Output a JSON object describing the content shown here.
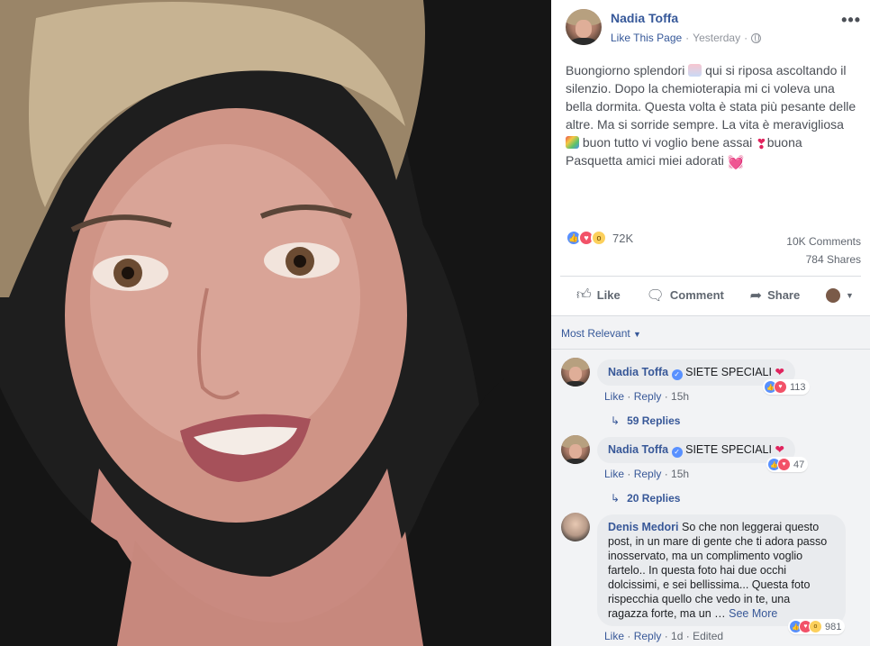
{
  "post": {
    "author": "Nadia Toffa",
    "like_page": "Like This Page",
    "separator": "·",
    "time": "Yesterday",
    "text_lines": [
      "Buongiorno splendori",
      "qui si riposa ascoltando il",
      "silenzio. Dopo la chemioterapia mi ci voleva una",
      "bella dormita. Questa volta è stata più pesante delle",
      "altre. Ma si sorride sempre. La vita è meravigliosa",
      "buon tutto vi voglio bene assai",
      "buona",
      "Pasquetta amici miei adorati"
    ],
    "reaction_count": "72K",
    "comments_count": "10K Comments",
    "shares_count": "784 Shares",
    "actions": {
      "like": "Like",
      "comment": "Comment",
      "share": "Share"
    }
  },
  "comments_section": {
    "sort_label": "Most Relevant",
    "comments": [
      {
        "author": "Nadia Toffa",
        "text": "SIETE SPECIALI",
        "like": "Like",
        "reply": "Reply",
        "time": "15h",
        "reaction_count": "113",
        "replies": "59 Replies"
      },
      {
        "author": "Nadia Toffa",
        "text": "SIETE SPECIALI",
        "like": "Like",
        "reply": "Reply",
        "time": "15h",
        "reaction_count": "47",
        "replies": "20 Replies"
      },
      {
        "author": "Denis Medori",
        "text_lines": [
          "So che non leggerai questo",
          "post, in un mare di gente che ti adora passo",
          "inosservato, ma un complimento voglio",
          "fartelo.. In questa foto hai due occhi",
          "dolcissimi, e sei bellissima... Questa foto",
          "rispecchia quello che vedo in te, una",
          "ragazza forte, ma un …"
        ],
        "see_more": "See More",
        "like": "Like",
        "reply": "Reply",
        "time": "1d",
        "edited": "Edited",
        "reaction_count": "981"
      }
    ]
  },
  "colors": {
    "link_blue": "#365899",
    "like_blue": "#5890ff",
    "love_red": "#f25268",
    "wow_yellow": "#fcd05c"
  }
}
